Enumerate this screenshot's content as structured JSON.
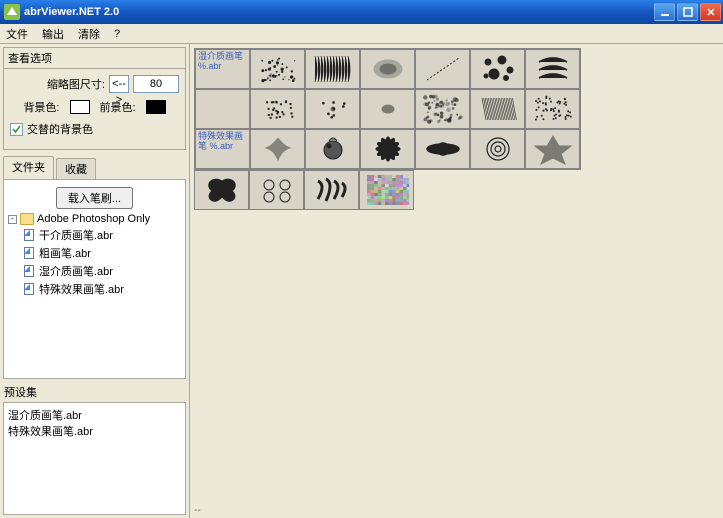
{
  "window": {
    "title": "abrViewer.NET 2.0"
  },
  "menu": {
    "file": "文件",
    "output": "输出",
    "clear": "清除",
    "help": "?"
  },
  "options": {
    "panel_title": "查看选项",
    "thumb_label": "缩略图尺寸:",
    "spin": "<-->",
    "thumb_value": "80",
    "bg_label": "背景色:",
    "fg_label": "前景色:",
    "alt_label": "交替的背景色",
    "alt_checked": true,
    "bg_color": "#ffffff",
    "fg_color": "#000000"
  },
  "tabs": {
    "files": "文件夹",
    "fav": "收藏"
  },
  "load_btn": "载入笔刷...",
  "tree": {
    "root": "Adobe Photoshop Only",
    "items": [
      "干介质画笔.abr",
      "粗画笔.abr",
      "湿介质画笔.abr",
      "特殊效果画笔.abr"
    ]
  },
  "preset": {
    "label": "预设集",
    "items": [
      "湿介质画笔.abr",
      "特殊效果画笔.abr"
    ]
  },
  "gallery": {
    "row_labels": [
      "湿介质画笔 %.abr",
      "",
      "特殊效果画笔 %.abr",
      ""
    ]
  },
  "status": "--"
}
